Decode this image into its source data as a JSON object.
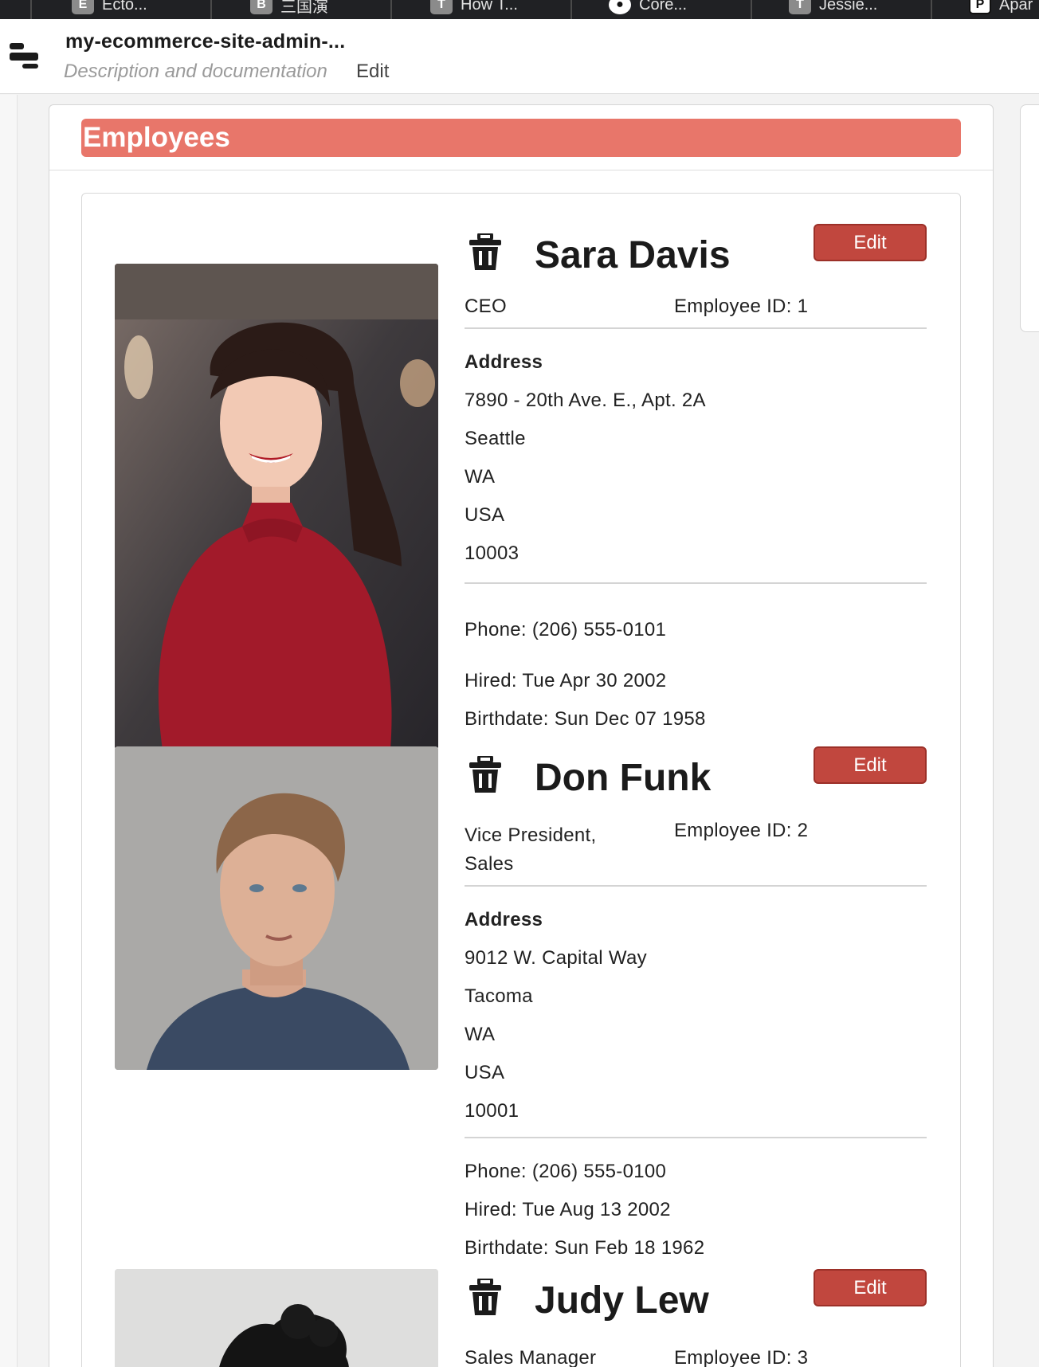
{
  "browser": {
    "tabs": [
      {
        "icon": "E",
        "label": "Ecto..."
      },
      {
        "icon": "B",
        "label": "三国演"
      },
      {
        "icon": "T",
        "label": "How T..."
      },
      {
        "icon": "",
        "label": "Core..."
      },
      {
        "icon": "T",
        "label": "Jessie..."
      },
      {
        "icon": "P",
        "label": "Apar"
      }
    ]
  },
  "app": {
    "title": "my-ecommerce-site-admin-...",
    "description": "Description and documentation",
    "description_edit": "Edit"
  },
  "section": {
    "title": "Employees"
  },
  "labels": {
    "edit": "Edit",
    "address": "Address"
  },
  "employees": [
    {
      "name": "Sara Davis",
      "title": "CEO",
      "employee_id": "Employee ID: 1",
      "street": "7890 - 20th Ave. E., Apt. 2A",
      "city": "Seattle",
      "region": "WA",
      "country": "USA",
      "postal": "10003",
      "phone": "Phone: (206) 555-0101",
      "hired": "Hired: Tue Apr 30 2002",
      "birthdate": "Birthdate: Sun Dec 07 1958"
    },
    {
      "name": "Don Funk",
      "title_line1": "Vice President,",
      "title_line2": "Sales",
      "employee_id": "Employee ID: 2",
      "street": "9012 W. Capital Way",
      "city": "Tacoma",
      "region": "WA",
      "country": "USA",
      "postal": "10001",
      "phone": "Phone: (206) 555-0100",
      "hired": "Hired: Tue Aug 13 2002",
      "birthdate": "Birthdate: Sun Feb 18 1962"
    },
    {
      "name": "Judy Lew",
      "title": "Sales Manager",
      "employee_id": "Employee ID: 3"
    }
  ],
  "colors": {
    "header_bar": "#e8766a",
    "edit_button": "#c1473e"
  }
}
